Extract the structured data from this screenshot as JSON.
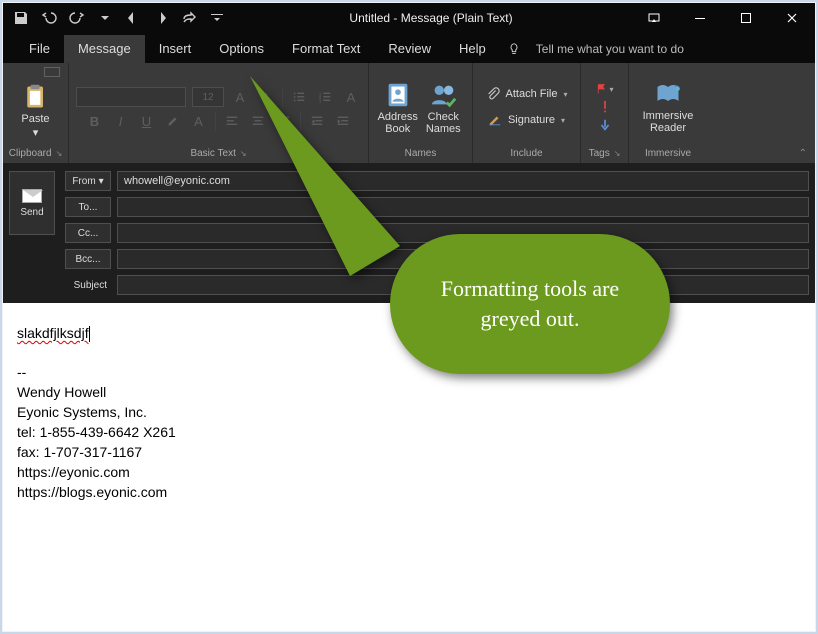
{
  "window": {
    "title": "Untitled  -  Message (Plain Text)"
  },
  "tabs": {
    "file": "File",
    "message": "Message",
    "insert": "Insert",
    "options": "Options",
    "format_text": "Format Text",
    "review": "Review",
    "help": "Help",
    "tell_me": "Tell me what you want to do"
  },
  "ribbon": {
    "clipboard": {
      "paste": "Paste",
      "label": "Clipboard"
    },
    "basic_text": {
      "label": "Basic Text",
      "font_size": "12"
    },
    "names": {
      "address_book": "Address\nBook",
      "check_names": "Check\nNames",
      "label": "Names"
    },
    "include": {
      "attach_file": "Attach File",
      "signature": "Signature",
      "label": "Include"
    },
    "tags": {
      "label": "Tags"
    },
    "immersive": {
      "reader": "Immersive\nReader",
      "label": "Immersive"
    }
  },
  "address": {
    "send": "Send",
    "from_btn": "From",
    "from_value": "whowell@eyonic.com",
    "to": "To...",
    "cc": "Cc...",
    "bcc": "Bcc...",
    "subject": "Subject"
  },
  "body": {
    "typed": "slakdfjlksdjf",
    "sig_sep": "--",
    "sig_name": "Wendy Howell",
    "sig_company": "Eyonic Systems, Inc.",
    "sig_tel": "tel: 1-855-439-6642 X261",
    "sig_fax": "fax: 1-707-317-1167",
    "sig_url1": "https://eyonic.com",
    "sig_url2": "https://blogs.eyonic.com"
  },
  "callout": {
    "text": "Formatting tools are greyed out."
  }
}
